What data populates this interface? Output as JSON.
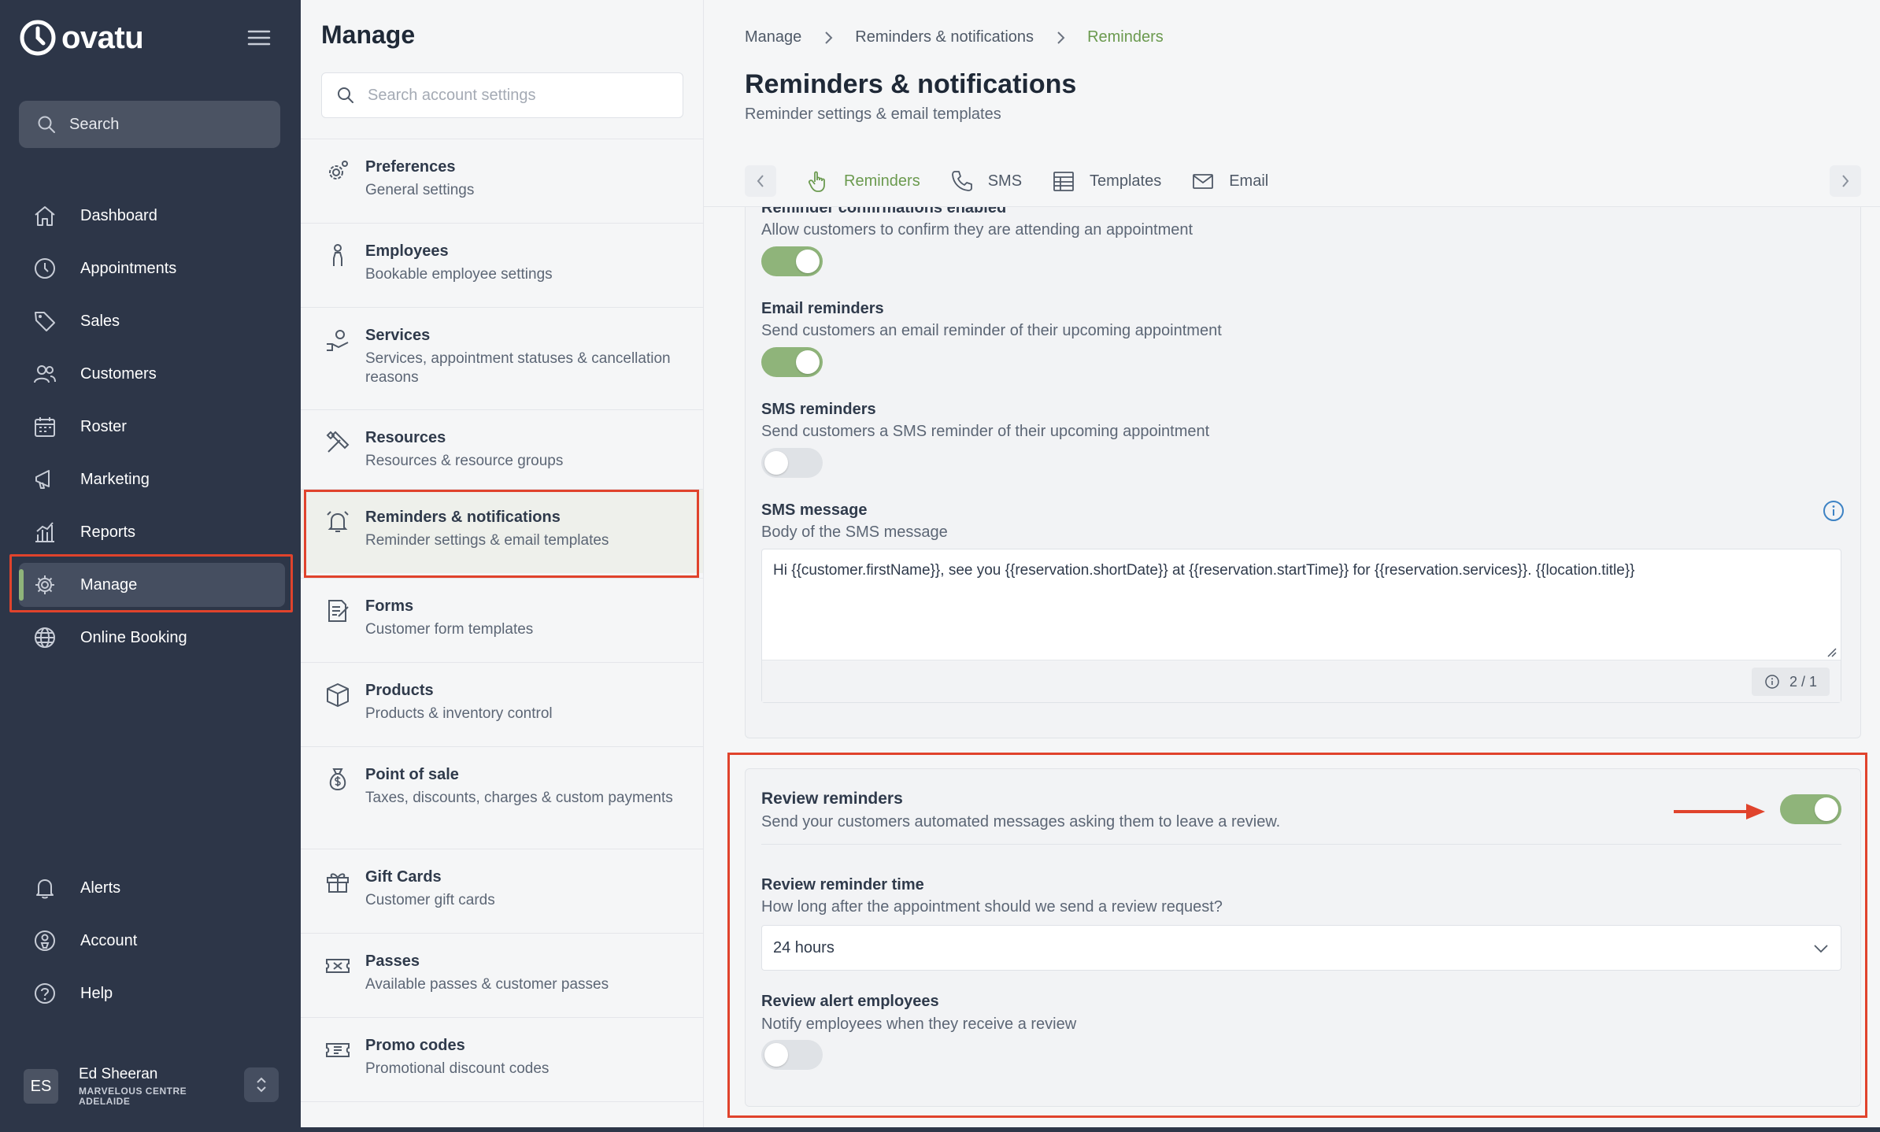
{
  "app": {
    "logo_text": "ovatu"
  },
  "nav": {
    "search_label": "Search",
    "items": [
      {
        "label": "Dashboard",
        "icon": "home-icon"
      },
      {
        "label": "Appointments",
        "icon": "clock-icon"
      },
      {
        "label": "Sales",
        "icon": "tag-icon"
      },
      {
        "label": "Customers",
        "icon": "users-icon"
      },
      {
        "label": "Roster",
        "icon": "calendar-icon"
      },
      {
        "label": "Marketing",
        "icon": "megaphone-icon"
      },
      {
        "label": "Reports",
        "icon": "chart-icon"
      },
      {
        "label": "Manage",
        "icon": "gear-icon"
      },
      {
        "label": "Online Booking",
        "icon": "globe-icon"
      }
    ],
    "bottom_items": [
      {
        "label": "Alerts",
        "icon": "bell-icon"
      },
      {
        "label": "Account",
        "icon": "account-icon"
      },
      {
        "label": "Help",
        "icon": "help-icon"
      }
    ],
    "user": {
      "initials": "ES",
      "name": "Ed Sheeran",
      "location": "MARVELOUS CENTRE ADELAIDE"
    }
  },
  "settings": {
    "title": "Manage",
    "search_placeholder": "Search account settings",
    "items": [
      {
        "title": "Preferences",
        "subtitle": "General settings"
      },
      {
        "title": "Employees",
        "subtitle": "Bookable employee settings"
      },
      {
        "title": "Services",
        "subtitle": "Services, appointment statuses & cancellation reasons"
      },
      {
        "title": "Resources",
        "subtitle": "Resources & resource groups"
      },
      {
        "title": "Reminders & notifications",
        "subtitle": "Reminder settings & email templates"
      },
      {
        "title": "Forms",
        "subtitle": "Customer form templates"
      },
      {
        "title": "Products",
        "subtitle": "Products & inventory control"
      },
      {
        "title": "Point of sale",
        "subtitle": "Taxes, discounts, charges & custom payments"
      },
      {
        "title": "Gift Cards",
        "subtitle": "Customer gift cards"
      },
      {
        "title": "Passes",
        "subtitle": "Available passes & customer passes"
      },
      {
        "title": "Promo codes",
        "subtitle": "Promotional discount codes"
      }
    ]
  },
  "main": {
    "breadcrumb": [
      "Manage",
      "Reminders & notifications",
      "Reminders"
    ],
    "title": "Reminders & notifications",
    "subtitle": "Reminder settings & email templates",
    "tabs": [
      {
        "label": "Reminders",
        "icon": "hand-icon"
      },
      {
        "label": "SMS",
        "icon": "phone-icon"
      },
      {
        "label": "Templates",
        "icon": "template-icon"
      },
      {
        "label": "Email",
        "icon": "email-icon"
      }
    ],
    "fields": {
      "confirmations": {
        "label": "Reminder confirmations enabled",
        "help": "Allow customers to confirm they are attending an appointment",
        "enabled": true
      },
      "email": {
        "label": "Email reminders",
        "help": "Send customers an email reminder of their upcoming appointment",
        "enabled": true
      },
      "sms": {
        "label": "SMS reminders",
        "help": "Send customers a SMS reminder of their upcoming appointment",
        "enabled": false
      },
      "sms_message": {
        "label": "SMS message",
        "help": "Body of the SMS message",
        "value": "Hi {{customer.firstName}}, see you {{reservation.shortDate}} at {{reservation.startTime}} for {{reservation.services}}. {{location.title}}",
        "counter": "2 / 1"
      }
    },
    "review": {
      "title": "Review reminders",
      "help": "Send your customers automated messages asking them to leave a review.",
      "enabled": true,
      "time_label": "Review reminder time",
      "time_help": "How long after the appointment should we send a review request?",
      "time_value": "24 hours",
      "alert_label": "Review alert employees",
      "alert_help": "Notify employees when they receive a review",
      "alert_enabled": false
    }
  },
  "colors": {
    "accent": "#8fb47a",
    "annotation": "#e0432c",
    "nav_bg": "#2d3648"
  }
}
